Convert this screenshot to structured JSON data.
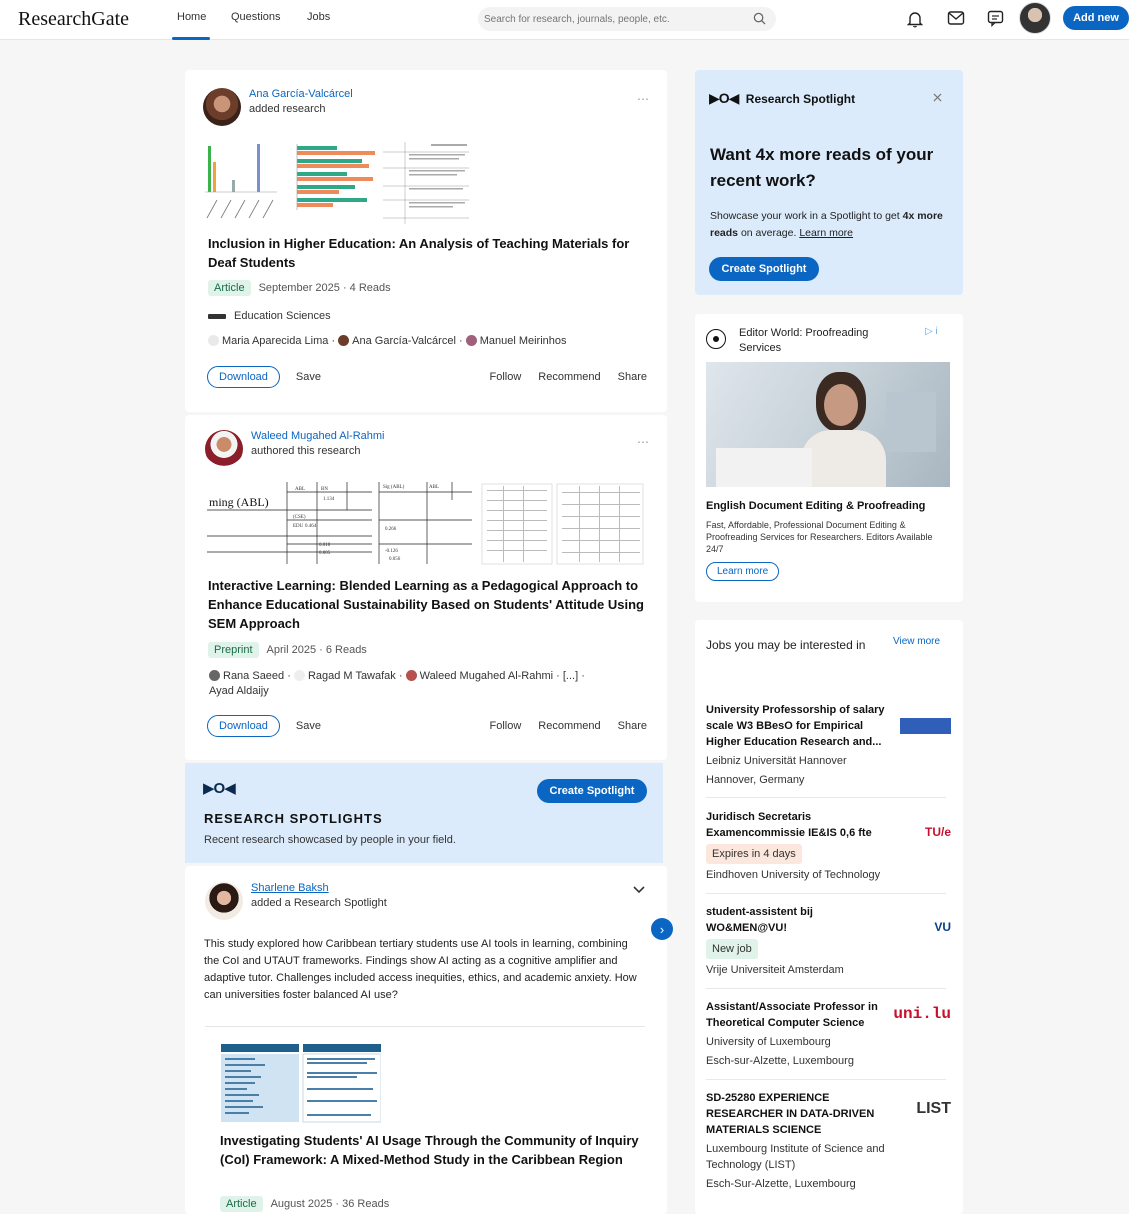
{
  "topbar": {
    "logo": "ResearchGate",
    "nav": [
      "Home",
      "Questions",
      "Jobs"
    ],
    "search_placeholder": "Search for research, journals, people, etc.",
    "add_new": "Add new"
  },
  "feed": [
    {
      "author": "Ana García-Valcárcel",
      "action": "added research",
      "title": "Inclusion in Higher Education: An Analysis of Teaching Materials for Deaf Students",
      "type": "Article",
      "meta": "September 2025 · 4 Reads",
      "journal": "Education Sciences",
      "authors": [
        "Maria Aparecida Lima",
        "Ana García-Valcárcel",
        "Manuel Meirinhos"
      ],
      "actions": {
        "download": "Download",
        "save": "Save",
        "follow": "Follow",
        "recommend": "Recommend",
        "share": "Share"
      }
    },
    {
      "author": "Waleed Mugahed Al-Rahmi",
      "action": "authored this research",
      "title": "Interactive Learning: Blended Learning as a Pedagogical Approach to Enhance Educational Sustainability Based on Students' Attitude Using SEM Approach",
      "type": "Preprint",
      "meta": "April 2025 · 6 Reads",
      "authors": [
        "Rana Saeed",
        "Ragad M Tawafak",
        "Waleed Mugahed Al-Rahmi",
        "[...]",
        "Ayad Aldaijy"
      ],
      "thumb_text": "ming (ABL)",
      "actions": {
        "download": "Download",
        "save": "Save",
        "follow": "Follow",
        "recommend": "Recommend",
        "share": "Share"
      }
    }
  ],
  "spotlights_banner": {
    "logo": "▶O◀",
    "heading": "RESEARCH SPOTLIGHTS",
    "sub": "Recent research showcased by people in your field.",
    "button": "Create Spotlight"
  },
  "spotlight_post": {
    "author": "Sharlene Baksh",
    "action": "added a Research Spotlight",
    "body": "This study explored how Caribbean tertiary students use AI tools in learning, combining the CoI and UTAUT frameworks. Findings show AI acting as a cognitive amplifier and adaptive tutor. Challenges included access inequities, ethics, and academic anxiety. How can universities foster balanced AI use?",
    "title": "Investigating Students' AI Usage Through the Community of Inquiry (CoI) Framework: A Mixed-Method Study in the Caribbean Region",
    "type": "Article",
    "meta": "August 2025 · 36 Reads"
  },
  "sidebar": {
    "spotlight": {
      "label": "Research Spotlight",
      "heading": "Want 4x more reads of your recent work?",
      "body_pre": "Showcase your work in a Spotlight to get ",
      "body_bold": "4x more reads",
      "body_post": " on average. ",
      "learn_more": "Learn more",
      "button": "Create Spotlight"
    },
    "ad": {
      "advertiser": "Editor World: Proofreading Services",
      "title": "English Document Editing & Proofreading",
      "body": "Fast, Affordable, Professional Document Editing & Proofreading Services for Researchers. Editors Available 24/7",
      "button": "Learn more"
    },
    "jobs": {
      "heading": "Jobs you may be interested in",
      "view_more": "View more",
      "items": [
        {
          "title": "University Professorship of salary scale W3 BBesO for Empirical Higher Education Research and...",
          "org": "Leibniz Universität Hannover",
          "location": "Hannover, Germany"
        },
        {
          "title": "Juridisch Secretaris Examencommissie IE&IS 0,6 fte",
          "badge": "Expires in 4 days",
          "org": "Eindhoven University of Technology",
          "logo": "TU/e"
        },
        {
          "title": "student-assistent bij WO&MEN@VU!",
          "badge": "New job",
          "org": "Vrije Universiteit Amsterdam",
          "logo": "VU"
        },
        {
          "title": "Assistant/Associate Professor in Theoretical Computer Science",
          "org": "University of Luxembourg",
          "location": "Esch-sur-Alzette, Luxembourg",
          "logo": "uni.lu"
        },
        {
          "title": "SD-25280 EXPERIENCE RESEARCHER IN DATA-DRIVEN MATERIALS SCIENCE",
          "org": "Luxembourg Institute of Science and Technology (LIST)",
          "location": "Esch-Sur-Alzette, Luxembourg",
          "logo": "LIST"
        }
      ]
    }
  }
}
